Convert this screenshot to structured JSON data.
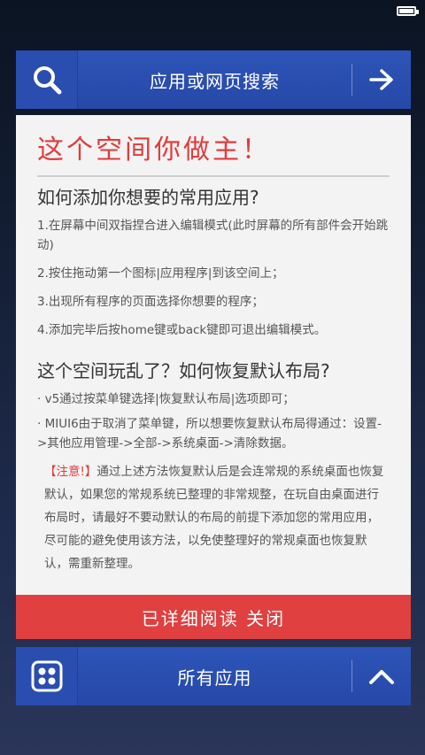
{
  "search_bar": {
    "title": "应用或网页搜索"
  },
  "card": {
    "headline": "这个空间你做主！",
    "section1": {
      "title": "如何添加你想要的常用应用?",
      "items": [
        "1.在屏幕中间双指捏合进入编辑模式(此时屏幕的所有部件会开始跳动)",
        "2.按住拖动第一个图标|应用程序|到该空间上；",
        "3.出现所有程序的页面选择你想要的程序；",
        "4.添加完毕后按home键或back键即可退出编辑模式。"
      ]
    },
    "section2": {
      "title": "这个空间玩乱了？如何恢复默认布局?",
      "items": [
        "· v5通过按菜单键选择|恢复默认布局|选项即可；",
        "· MIUI6由于取消了菜单键，所以想要恢复默认布局得通过：设置->其他应用管理->全部->系统桌面->清除数据。"
      ],
      "note_tag": "【注意!】",
      "note_text": "通过上述方法恢复默认后是会连常规的系统桌面也恢复默认，如果您的常规系统已整理的非常规整，在玩自由桌面进行布局时，请最好不要动默认的布局的前提下添加您的常用应用，尽可能的避免使用该方法，以免使整理好的常规桌面也恢复默认，需重新整理。"
    },
    "close_label": "已详细阅读 关闭"
  },
  "bottom_bar": {
    "title": "所有应用"
  },
  "colors": {
    "accent_blue": "#2649a8",
    "accent_red": "#e04040",
    "headline_red": "#e23b3b"
  }
}
